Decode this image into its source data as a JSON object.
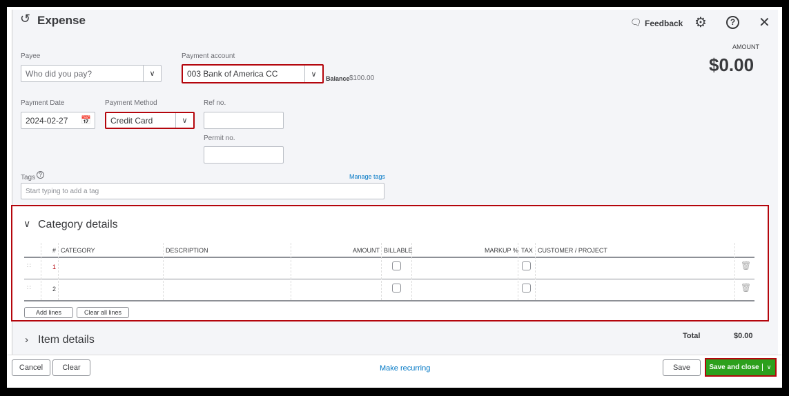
{
  "header": {
    "title": "Expense",
    "feedback": "Feedback"
  },
  "amount": {
    "label": "AMOUNT",
    "value": "$0.00"
  },
  "form": {
    "payee_label": "Payee",
    "payee_placeholder": "Who did you pay?",
    "account_label": "Payment account",
    "account_value": "003 Bank of America CC",
    "balance_label": "Balance",
    "balance_value": "$100.00",
    "date_label": "Payment Date",
    "date_value": "2024-02-27",
    "method_label": "Payment Method",
    "method_value": "Credit Card",
    "ref_label": "Ref no.",
    "permit_label": "Permit no.",
    "tags_label": "Tags",
    "manage_tags": "Manage tags",
    "tags_placeholder": "Start typing to add a tag"
  },
  "category": {
    "title": "Category details",
    "columns": [
      "#",
      "CATEGORY",
      "DESCRIPTION",
      "AMOUNT",
      "BILLABLE",
      "MARKUP %",
      "TAX",
      "CUSTOMER / PROJECT"
    ],
    "rows": [
      {
        "num": "1"
      },
      {
        "num": "2"
      }
    ],
    "add_lines": "Add lines",
    "clear_lines": "Clear all lines"
  },
  "item": {
    "title": "Item details"
  },
  "total": {
    "label": "Total",
    "value": "$0.00"
  },
  "footer": {
    "cancel": "Cancel",
    "clear": "Clear",
    "recurring": "Make recurring",
    "save": "Save",
    "save_close": "Save and close"
  }
}
